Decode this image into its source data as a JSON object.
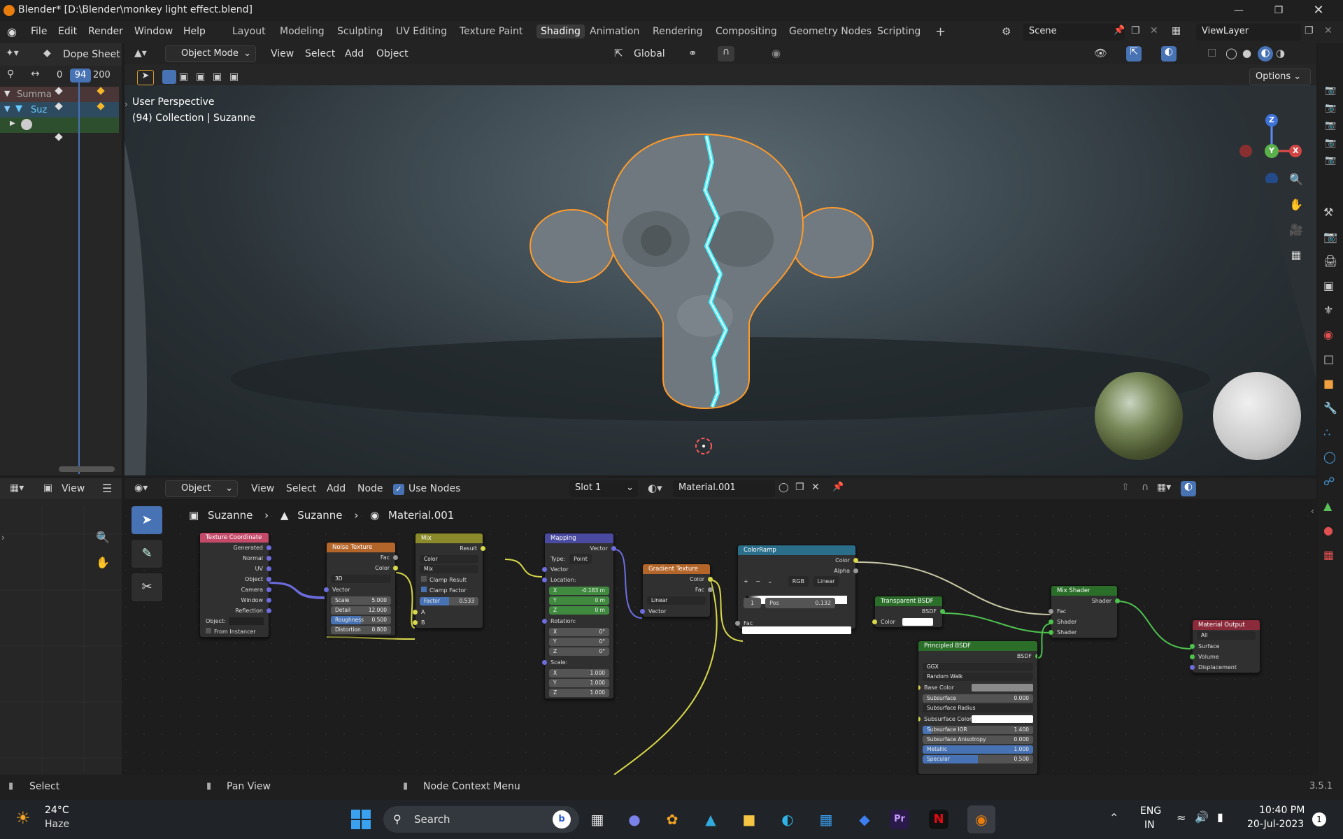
{
  "titlebar": {
    "title": "Blender* [D:\\Blender\\monkey light effect.blend]"
  },
  "menu": {
    "file": "File",
    "edit": "Edit",
    "render": "Render",
    "window": "Window",
    "help": "Help"
  },
  "workspaces": [
    "Layout",
    "Modeling",
    "Sculpting",
    "UV Editing",
    "Texture Paint",
    "Shading",
    "Animation",
    "Rendering",
    "Compositing",
    "Geometry Nodes",
    "Scripting"
  ],
  "active_workspace": "Shading",
  "scene": {
    "name": "Scene",
    "view_layer": "ViewLayer"
  },
  "dopesheet": {
    "editor": "Dope Sheet",
    "frame_start": "0",
    "frame_current": "94",
    "frame_end": "200",
    "rows": [
      "Summa",
      "Suz"
    ]
  },
  "viewport": {
    "mode": "Object Mode",
    "view": "View",
    "select": "Select",
    "add": "Add",
    "object": "Object",
    "orientation": "Global",
    "options": "Options",
    "perspective": "User Perspective",
    "collection": "(94) Collection | Suzanne",
    "gizmo_z": "Z",
    "gizmo_y": "Y",
    "gizmo_x": "X"
  },
  "node_header": {
    "object": "Object",
    "view": "View",
    "select": "Select",
    "add": "Add",
    "node": "Node",
    "use_nodes": "Use Nodes",
    "slot": "Slot 1",
    "material": "Material.001"
  },
  "node_left": {
    "view": "View"
  },
  "breadcrumb": [
    "Suzanne",
    "Suzanne",
    "Material.001"
  ],
  "nodes": {
    "texcoord": {
      "title": "Texture Coordinate",
      "outputs": [
        "Generated",
        "Normal",
        "UV",
        "Object",
        "Camera",
        "Window",
        "Reflection"
      ],
      "object_label": "Object:",
      "from_instancer": "From Instancer"
    },
    "noise": {
      "title": "Noise Texture",
      "outputs": [
        "Fac",
        "Color"
      ],
      "dim": "3D",
      "vector": "Vector",
      "scale_l": "Scale",
      "scale_v": "5.000",
      "detail_l": "Detail",
      "detail_v": "12.000",
      "rough_l": "Roughness",
      "rough_v": "0.500",
      "dist_l": "Distortion",
      "dist_v": "0.800"
    },
    "mix": {
      "title": "Mix",
      "result": "Result",
      "type": "Color",
      "blend": "Mix",
      "clamp_result": "Clamp Result",
      "clamp_factor": "Clamp Factor",
      "factor_l": "Factor",
      "factor_v": "0.533",
      "a": "A",
      "b": "B"
    },
    "mapping": {
      "title": "Mapping",
      "vector_out": "Vector",
      "type_l": "Type:",
      "type_v": "Point",
      "vector_in": "Vector",
      "location": "Location:",
      "lx": "-0.183 m",
      "ly": "0 m",
      "lz": "0 m",
      "rotation": "Rotation:",
      "rx": "0°",
      "ry": "0°",
      "rz": "0°",
      "scale": "Scale:",
      "sx": "1.000",
      "sy": "1.000",
      "sz": "1.000"
    },
    "gradient": {
      "title": "Gradient Texture",
      "color": "Color",
      "fac": "Fac",
      "type": "Linear",
      "vector": "Vector"
    },
    "colorramp": {
      "title": "ColorRamp",
      "color": "Color",
      "alpha": "Alpha",
      "mode": "RGB",
      "interp": "Linear",
      "index": "1",
      "pos_l": "Pos",
      "pos_v": "0.132",
      "fac": "Fac"
    },
    "transparent": {
      "title": "Transparent BSDF",
      "bsdf": "BSDF",
      "color": "Color"
    },
    "principled": {
      "title": "Principled BSDF",
      "bsdf": "BSDF",
      "dist": "GGX",
      "sss": "Random Walk",
      "base": "Base Color",
      "subsurface_l": "Subsurface",
      "subsurface_v": "0.000",
      "sss_radius": "Subsurface Radius",
      "sss_color": "Subsurface Color",
      "ior_l": "Subsurface IOR",
      "ior_v": "1.400",
      "aniso_l": "Subsurface Anisotropy",
      "aniso_v": "0.000",
      "metal_l": "Metallic",
      "metal_v": "1.000",
      "spec_l": "Specular",
      "spec_v": "0.500"
    },
    "mixshader": {
      "title": "Mix Shader",
      "shader_out": "Shader",
      "fac": "Fac",
      "shader1": "Shader",
      "shader2": "Shader"
    },
    "output": {
      "title": "Material Output",
      "target": "All",
      "surface": "Surface",
      "volume": "Volume",
      "displacement": "Displacement"
    }
  },
  "status": {
    "select": "Select",
    "pan": "Pan View",
    "context": "Node Context Menu",
    "version": "3.5.1"
  },
  "taskbar": {
    "temp": "24°C",
    "weather": "Haze",
    "search": "Search",
    "lang1": "ENG",
    "lang2": "IN",
    "time": "10:40 PM",
    "date": "20-Jul-2023",
    "notif": "1"
  },
  "colors": {
    "accent": "#4772b3",
    "selection": "#ff9b2b",
    "lightning": "#3ff0ff",
    "node_header_texture": "#c44a6a"
  }
}
